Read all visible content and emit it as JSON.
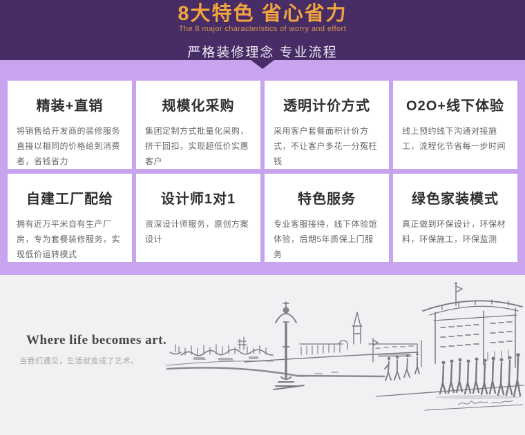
{
  "colors": {
    "header_bg": "#482c66",
    "accent_orange": "#f0a43e",
    "section_bg": "#c9a4ee",
    "card_bg": "#ffffff",
    "art_bg": "#f1f0f2"
  },
  "header": {
    "title": "8大特色 省心省力",
    "subtitle": "The 8 major characteristics of worry and effort",
    "tagline": "严格装修理念 专业流程",
    "arrow_icon": "arrow-down-icon"
  },
  "features": {
    "cards": [
      {
        "title": "精装+直销",
        "desc": "将销售给开发商的装修服务直接以相同的价格给到消费者，省钱省力"
      },
      {
        "title": "规模化采购",
        "desc": "集团定制方式批量化采购，挤干回扣，实现超低价实惠客户"
      },
      {
        "title": "透明计价方式",
        "desc": "采用客户套餐面积计价方式，不让客户多花一分冤枉钱"
      },
      {
        "title": "O2O+线下体验",
        "desc": "线上预约线下沟通对接施工，流程化节省每一步时间"
      },
      {
        "title": "自建工厂配给",
        "desc": "拥有近万平米自有生产厂房，专为套餐装修服务，实现低价运转模式"
      },
      {
        "title": "设计师1对1",
        "desc": "资深设计师服务，原创方案设计"
      },
      {
        "title": "特色服务",
        "desc": "专业客服接待，线下体验馆体验，后期5年质保上门服务"
      },
      {
        "title": "绿色家装模式",
        "desc": "真正做到环保设计，环保材料，环保施工，环保监测"
      }
    ]
  },
  "art_section": {
    "headline": "Where life becomes art.",
    "caption": "当我们遇见，生活就变成了艺术。",
    "illustration": "city-sketch-illustration"
  }
}
